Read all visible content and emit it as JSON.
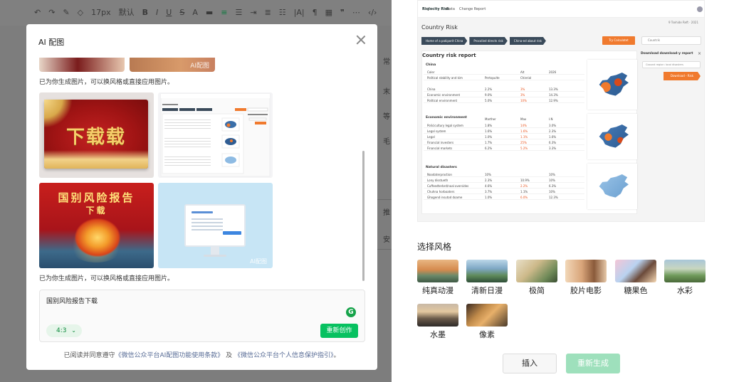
{
  "toolbar": {
    "font_size": "17px",
    "font_family": "默认",
    "items": [
      "undo-icon",
      "redo-icon",
      "format-painter-icon",
      "eraser-icon",
      "font-size",
      "font-family",
      "bold-icon",
      "italic-icon",
      "underline-icon",
      "strikethrough-icon",
      "highlight-icon",
      "align-icon",
      "indent-icon",
      "line-height-icon",
      "list-icon",
      "paragraph-icon",
      "letter-spacing-icon",
      "table-icon",
      "quote-icon",
      "more-icon",
      "code-icon"
    ]
  },
  "editor_side": {
    "labels": [
      "常",
      "末",
      "等",
      "毛",
      "推",
      "安"
    ]
  },
  "modal": {
    "title": "AI 配图",
    "watermark": "AI配图",
    "generated_note": "已为你生成图片，可以换风格或直接应用图片。",
    "images": [
      {
        "id": "img-1",
        "caption": "下载载"
      },
      {
        "id": "img-2",
        "caption": ""
      },
      {
        "id": "img-3",
        "caption_line1": "国别风险报告",
        "caption_line2": "下载"
      },
      {
        "id": "img-4",
        "caption": "AI配图"
      }
    ],
    "prompt": "国别风险报告下载",
    "ratio": "4:3",
    "regenerate_label": "重新创作",
    "agreement_prefix": "已阅读并同意遵守",
    "agreement_link1": "《微信公众平台AI配图功能使用条款》",
    "agreement_middle": "及",
    "agreement_link2": "《微信公众平台个人信息保护指引》",
    "agreement_suffix": "。"
  },
  "preview": {
    "nav_logo": "Riqlocity Risk",
    "nav_items": [
      "Data",
      "Change Report"
    ],
    "date": "9 Tsehide Reft · 2021",
    "title": "Country Risk",
    "crumbs": [
      "Home of a pakiporit China",
      "Procolied directs risk",
      "China-ed about risk"
    ],
    "calc_button": "Try Calculatet",
    "search_placeholder": "Countrik",
    "report_title": "Country risk report",
    "sections": [
      {
        "name": "China",
        "header": [
          "Coler",
          "",
          "Alt",
          "2026"
        ],
        "rows": [
          [
            "Political stability and kim",
            "Pertopulte",
            "Chierial",
            ""
          ],
          [
            "China",
            "2.2%",
            "3%",
            "13.3%"
          ],
          [
            "Economic environment",
            "9.0%",
            "3%",
            "14.3%"
          ],
          [
            "Political environment",
            "5.0%",
            "10%",
            "12.9%"
          ]
        ]
      },
      {
        "name": "Economic environment",
        "header": [
          "N",
          "Marther",
          "Max",
          "I.N"
        ],
        "rows": [
          [
            "Policicultury legal system",
            "1.8%",
            "14%",
            "3.0%"
          ],
          [
            "Legal system",
            "1.6%",
            "1.6%",
            "2.3%"
          ],
          [
            "Legal",
            "1.0%",
            "1.1%",
            "1.6%"
          ],
          [
            "Financial investers",
            "1.7%",
            "25%",
            "6.3%"
          ],
          [
            "Financial markets",
            "6.2%",
            "5.2%",
            "3.3%"
          ]
        ]
      },
      {
        "name": "Natural disasters",
        "header": [
          "Noodaterproction",
          "10%",
          "",
          "10%"
        ],
        "rows": [
          [
            "Lony disstueth",
            "2.3%",
            "10.9%",
            "10%"
          ],
          [
            "Cuffeedterbrd/noal oversides",
            "4.6%",
            "2.2%",
            "6.3%"
          ],
          [
            "Chuhna horboaters",
            "3.7%",
            "1.1%",
            "10%"
          ],
          [
            "Ghogend insutod doame",
            "1.0%",
            "6.0%",
            "12.3%"
          ]
        ]
      }
    ],
    "side_heading": "Download download-y report",
    "side_select": "Coound region: local disasters",
    "side_download": "Download - Risk"
  },
  "styles": {
    "heading": "选择风格",
    "items": [
      {
        "label": "纯真动漫"
      },
      {
        "label": "清新日漫"
      },
      {
        "label": "极简"
      },
      {
        "label": "胶片电影"
      },
      {
        "label": "糖果色"
      },
      {
        "label": "水彩"
      },
      {
        "label": "水墨"
      },
      {
        "label": "像素"
      }
    ]
  },
  "actions": {
    "insert_label": "插入",
    "regenerate_label": "重新生成"
  },
  "colors": {
    "accent_green": "#07c160",
    "disabled_green": "#9ee0bc",
    "report_orange": "#f07a2e",
    "overlay_gray": "#7d7d7d"
  }
}
